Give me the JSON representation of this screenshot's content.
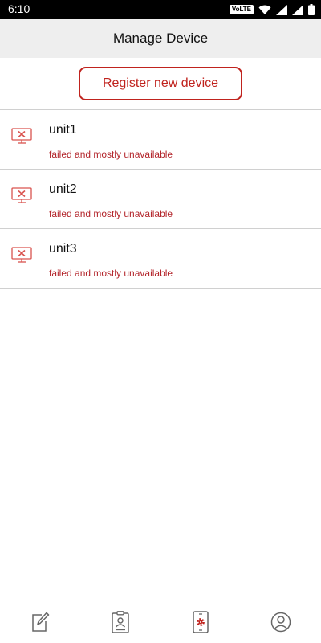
{
  "status_bar": {
    "time": "6:10",
    "volte": "VoLTE",
    "icons": [
      "wifi-icon",
      "signal-icon",
      "battery-icon"
    ]
  },
  "header": {
    "title": "Manage Device"
  },
  "register_button": {
    "label": "Register new device"
  },
  "devices": [
    {
      "name": "unit1",
      "status": "failed and mostly unavailable",
      "icon": "device-offline-icon"
    },
    {
      "name": "unit2",
      "status": "failed and mostly unavailable",
      "icon": "device-offline-icon"
    },
    {
      "name": "unit3",
      "status": "failed and mostly unavailable",
      "icon": "device-offline-icon"
    }
  ],
  "bottom_nav": {
    "items": [
      {
        "icon": "edit-icon",
        "active": false
      },
      {
        "icon": "id-badge-icon",
        "active": false
      },
      {
        "icon": "device-settings-icon",
        "active": true
      },
      {
        "icon": "profile-icon",
        "active": false
      }
    ]
  },
  "colors": {
    "accent": "#c0231e",
    "status_error": "#b3252b",
    "app_bar_bg": "#eeeeee",
    "divider": "#d0d0d0",
    "icon_gray": "#666666"
  }
}
